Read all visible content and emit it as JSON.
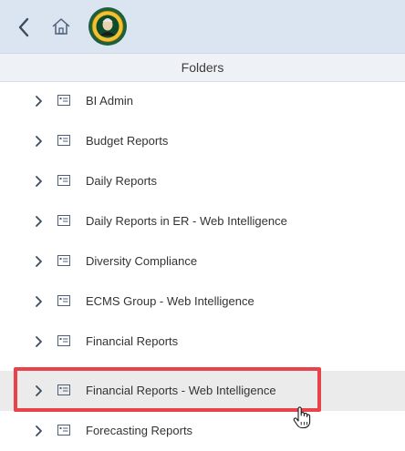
{
  "header": {
    "back_icon": "chevron-left-icon",
    "home_icon": "home-icon",
    "logo_icon": "washington-state-seal-logo"
  },
  "panel": {
    "title": "Folders"
  },
  "folders": [
    {
      "label": "BI Admin"
    },
    {
      "label": "Budget Reports"
    },
    {
      "label": "Daily Reports"
    },
    {
      "label": "Daily Reports in ER - Web Intelligence"
    },
    {
      "label": "Diversity Compliance"
    },
    {
      "label": "ECMS Group - Web Intelligence"
    },
    {
      "label": "Financial Reports"
    },
    {
      "label": "Financial Reports - Web Intelligence",
      "highlighted": true
    },
    {
      "label": "Forecasting Reports"
    }
  ],
  "colors": {
    "topbar": "#dbe5f1",
    "panel_header": "#eef2f6",
    "hover_row": "#ebebeb",
    "highlight_border": "#e8424a",
    "icon": "#4d5f78"
  }
}
